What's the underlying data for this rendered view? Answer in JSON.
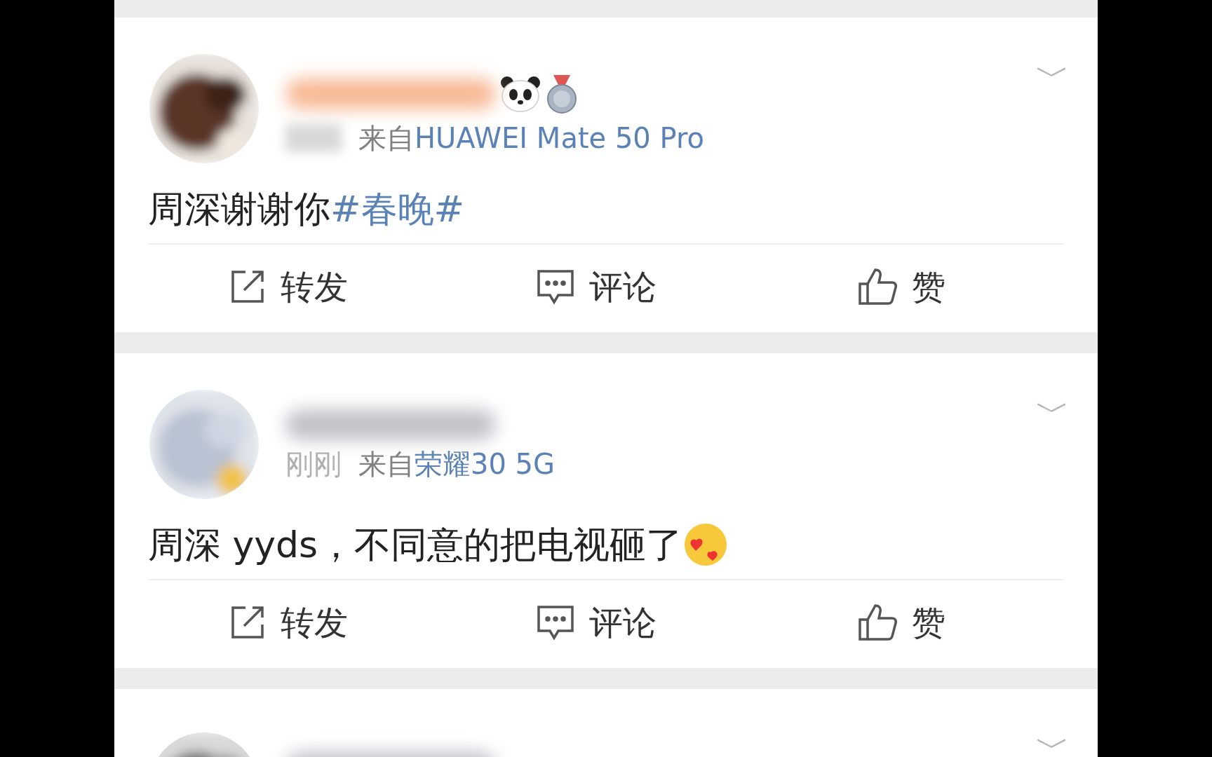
{
  "posts": [
    {
      "kind": "full",
      "chevron": "﹀",
      "source_prefix": "来自",
      "device": "HUAWEI Mate 50 Pro",
      "text": "周深谢谢你",
      "topic": "#春晚#",
      "badges": true,
      "emoji": false,
      "actions": [
        {
          "kind": "repost",
          "label": "转发"
        },
        {
          "kind": "comment",
          "label": "评论"
        },
        {
          "kind": "like",
          "label": "赞"
        }
      ]
    },
    {
      "kind": "full",
      "chevron": "﹀",
      "time": "刚刚",
      "source_prefix": "来自",
      "device": "荣耀30 5G",
      "text": "周深 yyds，不同意的把电视砸了",
      "badges": false,
      "emoji": true,
      "actions": [
        {
          "kind": "repost",
          "label": "转发"
        },
        {
          "kind": "comment",
          "label": "评论"
        },
        {
          "kind": "like",
          "label": "赞"
        }
      ]
    },
    {
      "kind": "partial",
      "chevron": "﹀"
    }
  ]
}
